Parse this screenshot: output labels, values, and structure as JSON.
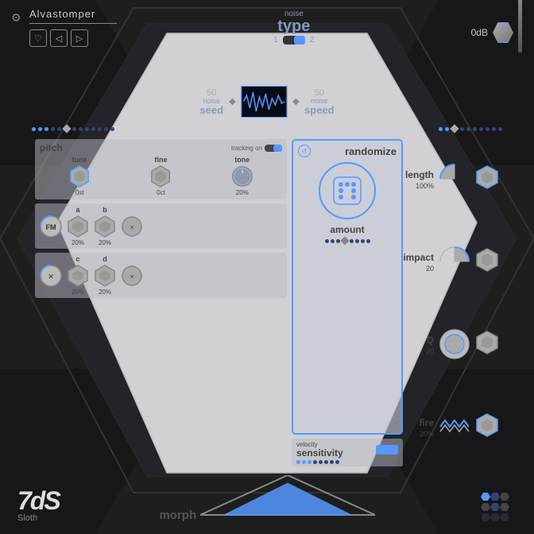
{
  "app": {
    "plugin_name": "Alvastomper",
    "logo_main": "7dS",
    "logo_sub": "Sloth",
    "db_value": "0dB"
  },
  "noise": {
    "type_label": "noise",
    "type_title": "type",
    "switch_1": "1",
    "switch_2": "2",
    "seed_label_sm": "noise",
    "seed_label": "seed",
    "seed_value": "50",
    "speed_label_sm": "noise",
    "speed_label": "speed",
    "speed_value": "50"
  },
  "pitch": {
    "label": "pitch",
    "tracking_label": "tracking on",
    "tune_label": "tune",
    "tune_value": "0st",
    "fine_label": "fine",
    "fine_value": "0ct",
    "tone_label": "tone",
    "tone_value": "20%"
  },
  "fm": {
    "label": "FM",
    "a_label": "a",
    "a_value": "20%",
    "b_label": "b",
    "b_value": "20%"
  },
  "cd": {
    "c_label": "c",
    "c_value": "20%",
    "d_label": "d",
    "d_value": "20%"
  },
  "randomize": {
    "label": "randomize",
    "amount_label": "amount"
  },
  "velocity": {
    "label_sm": "velocity",
    "label": "sensitivity"
  },
  "right_panel": {
    "length_label": "length",
    "length_value": "100%",
    "impact_label": "impact",
    "impact_value": "20",
    "q_label": "Q",
    "q_value": "20",
    "fire_label": "fire",
    "fire_value": "20%"
  },
  "morph": {
    "label": "morph"
  },
  "buttons": {
    "heart": "♡",
    "arrow_left": "◁",
    "arrow_right": "▷"
  }
}
